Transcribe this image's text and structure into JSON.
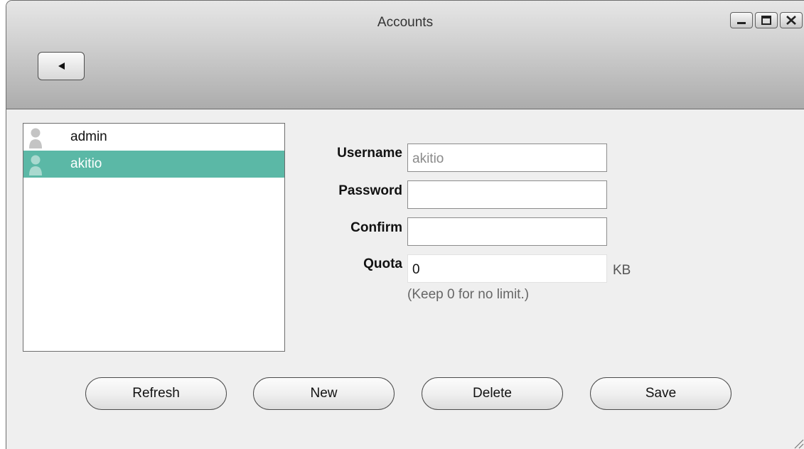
{
  "window": {
    "title": "Accounts",
    "controls": [
      "minimize-icon",
      "maximize-icon",
      "close-icon"
    ]
  },
  "toolbar": {
    "back_icon": "left-triangle-icon"
  },
  "users": [
    {
      "name": "admin",
      "selected": false,
      "icon": "user-icon"
    },
    {
      "name": "akitio",
      "selected": true,
      "icon": "user-icon"
    }
  ],
  "form": {
    "username_label": "Username",
    "username_value": "akitio",
    "password_label": "Password",
    "password_value": "",
    "confirm_label": "Confirm",
    "confirm_value": "",
    "quota_label": "Quota",
    "quota_value": "0",
    "quota_unit": "KB",
    "quota_hint": "(Keep 0 for no limit.)"
  },
  "buttons": {
    "refresh": "Refresh",
    "new": "New",
    "delete": "Delete",
    "save": "Save"
  },
  "colors": {
    "selection": "#5bb8a6",
    "window_bg": "#efefef"
  }
}
